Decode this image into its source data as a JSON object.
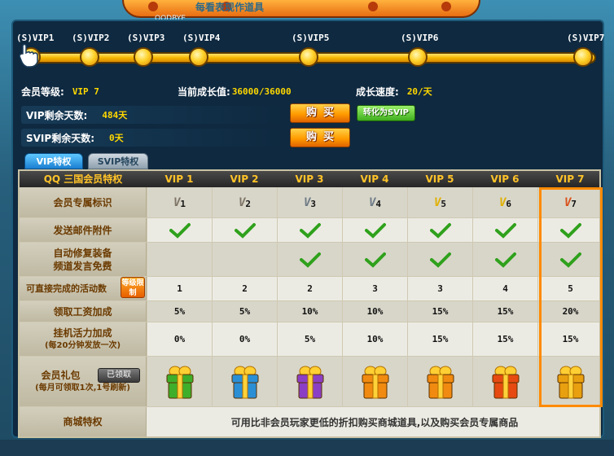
{
  "banner": {
    "text": "每看表现作道具",
    "small": "OODBYE"
  },
  "levels": [
    "(S)VIP1",
    "(S)VIP2",
    "(S)VIP3",
    "(S)VIP4",
    "(S)VIP5",
    "(S)VIP6",
    "(S)VIP7"
  ],
  "info": {
    "member_level_label": "会员等级:",
    "member_level_value": "VIP 7",
    "growth_label": "当前成长值:",
    "growth_value": "36000/36000",
    "speed_label": "成长速度:",
    "speed_value": "20/天",
    "vip_days_label": "VIP剩余天数:",
    "vip_days_value": "484天",
    "svip_days_label": "SVIP剩余天数:",
    "svip_days_value": "0天",
    "buy_label": "购买",
    "convert_label": "转化为SVIP"
  },
  "tabs": {
    "vip": "VIP特权",
    "svip": "SVIP特权"
  },
  "table": {
    "corner": "QQ 三国会员特权",
    "columns": [
      "VIP 1",
      "VIP 2",
      "VIP 3",
      "VIP 4",
      "VIP 5",
      "VIP 6",
      "VIP 7"
    ],
    "rows": {
      "badge": {
        "label": "会员专属标识",
        "values": [
          "1",
          "2",
          "3",
          "4",
          "5",
          "6",
          "7"
        ]
      },
      "mail": {
        "label": "发送邮件附件"
      },
      "repair": {
        "label1": "自动修复装备",
        "label2": "频道发言免费"
      },
      "activity": {
        "label": "可直接完成的活动数",
        "grade_badge": "等级限制",
        "values": [
          "1",
          "2",
          "2",
          "3",
          "3",
          "4",
          "5"
        ]
      },
      "salary": {
        "label": "领取工资加成",
        "values": [
          "5%",
          "5%",
          "10%",
          "10%",
          "15%",
          "15%",
          "20%"
        ]
      },
      "energy": {
        "label": "挂机活力加成",
        "sub": "(每20分钟发放一次)",
        "values": [
          "0%",
          "0%",
          "5%",
          "10%",
          "15%",
          "15%",
          "15%"
        ]
      },
      "gift": {
        "label": "会员礼包",
        "sub": "(每月可领取1次,1号刷新)",
        "claimed": "已领取"
      },
      "mall": {
        "label": "商城特权",
        "text": "可用比非会员玩家更低的折扣购买商城道具,以及购买会员专属商品"
      }
    }
  },
  "colors": {
    "gift": [
      "#3fae2a",
      "#2b8fd6",
      "#8b3fc4",
      "#f08a10",
      "#f08a10",
      "#e64a10",
      "#e8a010"
    ]
  }
}
